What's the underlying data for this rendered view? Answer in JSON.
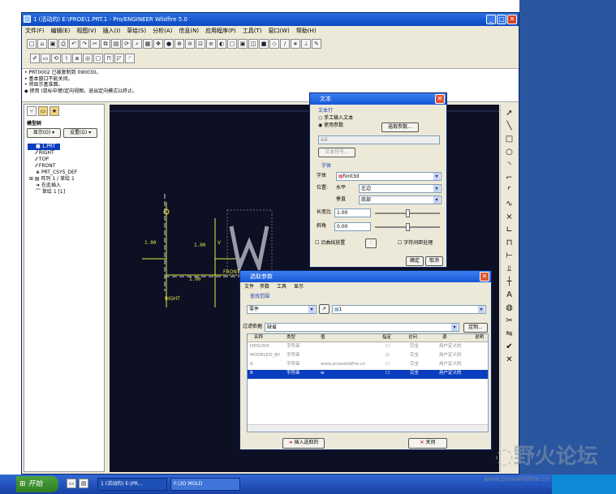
{
  "window": {
    "title": "1 (活动的) E:\\PROE\\1.PRT.1 - Pro/ENGINEER Wildfire 5.0",
    "min": "_",
    "max": "□",
    "close": "✕"
  },
  "menu": [
    "文件(F)",
    "编辑(E)",
    "视图(V)",
    "插入(I)",
    "草绘(S)",
    "分析(A)",
    "信息(N)",
    "应用程序(P)",
    "工具(T)",
    "窗口(W)",
    "帮助(H)"
  ],
  "messages": [
    "• PRT0002 已被复制到 090030。",
    "• 基本窗口不能关闭。",
    "• 将显示基准面。",
    "◆ 使用 (鼠标中键)定向视图，退出定向模式以终止。"
  ],
  "nav": {
    "tree_title": "模型树",
    "show_label": "显示(O) ▾",
    "settings_label": "设置(G) ▾",
    "items": [
      "1.PRT",
      "RIGHT",
      "TOP",
      "FRONT",
      "PRT_CSYS_DEF",
      "阵列 1 / 草绘 1",
      "在此插入",
      "草绘 1 [1]"
    ]
  },
  "gfx": {
    "dims": [
      "1.00",
      "1.00",
      "1.00"
    ],
    "labels": [
      "RIGHT",
      "FRONT",
      "V"
    ]
  },
  "text_dialog": {
    "title": "文本",
    "group": "文本行",
    "opt_manual": "手工输入文本",
    "opt_param": "使用参数",
    "select_param_btn": "选取参数...",
    "param_value": "&B",
    "text_symbol_btn": "文本符号...",
    "font_group": "字体",
    "font_label": "字体",
    "font_value": "font3d",
    "pos_label": "位置:",
    "h_label": "水平",
    "h_value": "左边",
    "v_label": "垂直",
    "v_value": "底部",
    "aspect_label": "长宽比",
    "aspect_value": "1.00",
    "slant_label": "斜角",
    "slant_value": "0.00",
    "along_curve": "沿曲线放置",
    "char_spacing": "字符间距处理",
    "ok": "确定",
    "cancel": "取消"
  },
  "param_dialog": {
    "title": "选取参数",
    "menus": [
      "文件",
      "参数",
      "工具",
      "显示"
    ],
    "lookup_label": "查找范围",
    "lookup_type": "零件",
    "lookup_target": "1",
    "filter_label": "过滤依据",
    "filter_value": "缺省",
    "more_btn": "定制...",
    "columns": [
      "名称",
      "类型",
      "值",
      "指定",
      "访问",
      "源",
      "说明"
    ],
    "rows": [
      {
        "name": "DESCRIP...",
        "type": "字符串",
        "value": "",
        "designate": "☐",
        "access": "完全",
        "source": "用户定义的",
        "desc": ""
      },
      {
        "name": "MODELED_BY",
        "type": "字符串",
        "value": "",
        "designate": "☑",
        "access": "完全",
        "source": "用户定义的",
        "desc": ""
      },
      {
        "name": "A",
        "type": "字符串",
        "value": "www.proewildfire.cn",
        "designate": "☐",
        "access": "完全",
        "source": "用户定义的",
        "desc": ""
      },
      {
        "name": "B",
        "type": "字符串",
        "value": "w",
        "designate": "☐",
        "access": "完全",
        "source": "用户定义的",
        "desc": ""
      }
    ],
    "insert_btn": "插入选取的",
    "close_btn": "关闭"
  },
  "taskbar": {
    "start": "开始",
    "task1": "1 (活动的) E:\\PR...",
    "task2": "F:\\3D MOLD"
  },
  "watermark": {
    "title": "野火论坛",
    "url": "www.proewildfire.cn"
  },
  "colors": {
    "selected_row": "#0a3dbf",
    "title_blue": "#1558d6",
    "gfx_bg": "#0d1022",
    "desktop": "#2a56a0"
  }
}
